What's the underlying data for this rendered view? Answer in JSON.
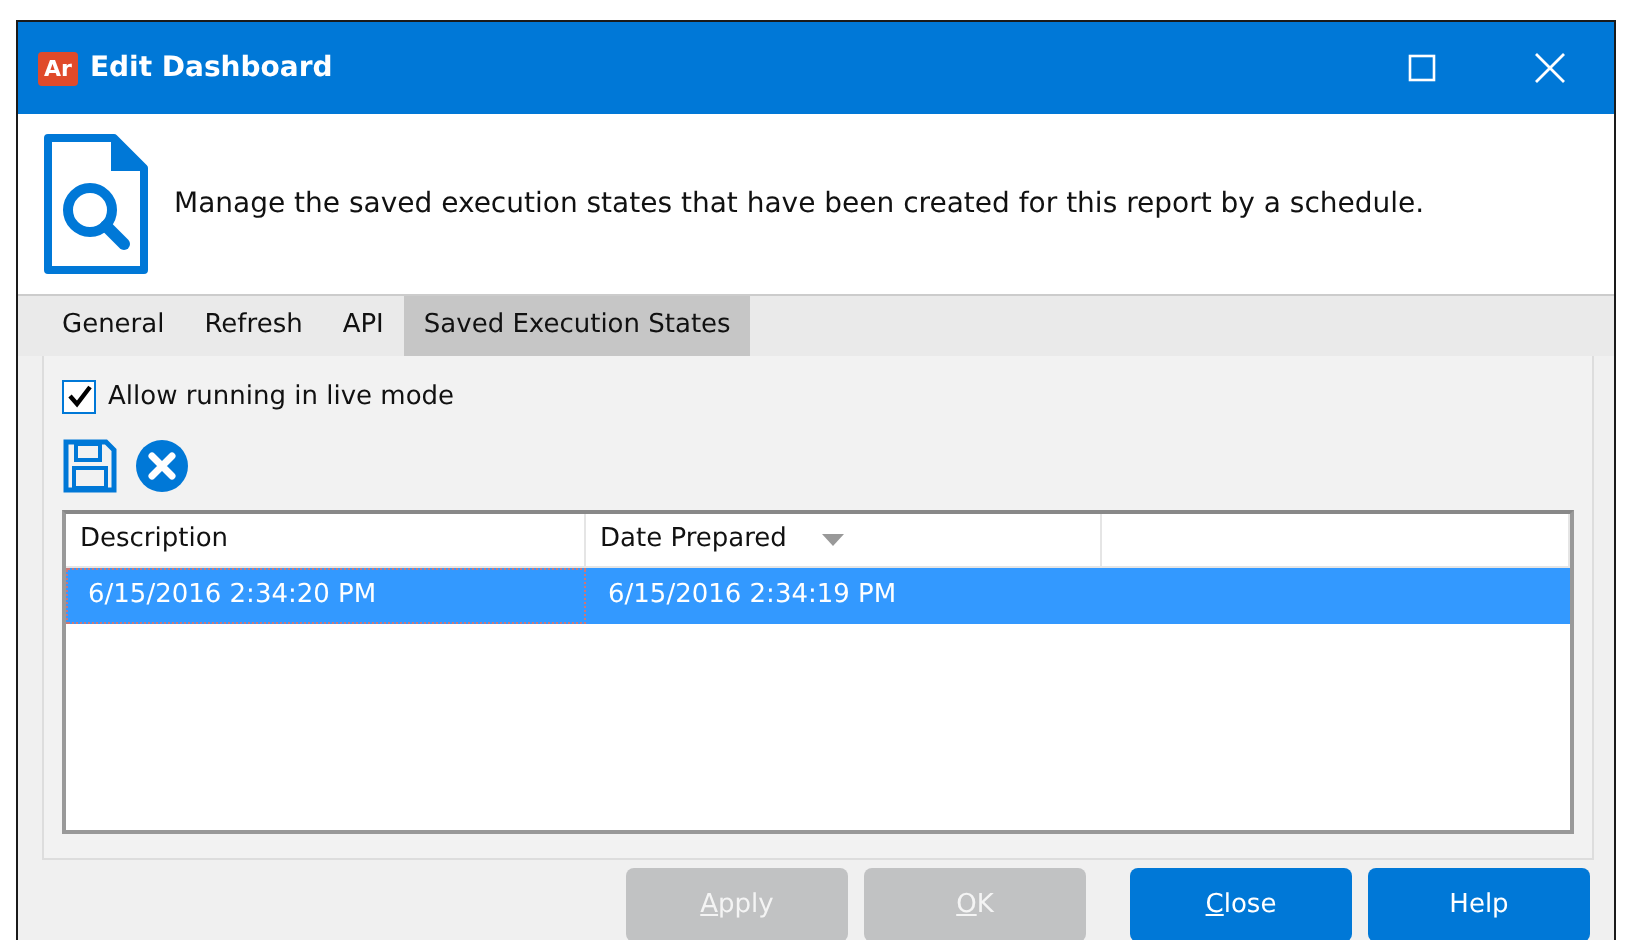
{
  "window": {
    "app_badge": "Ar",
    "title": "Edit Dashboard"
  },
  "header": {
    "message": "Manage the saved execution states that have been created for this report by a schedule."
  },
  "tabs": [
    {
      "label": "General",
      "selected": false
    },
    {
      "label": "Refresh",
      "selected": false
    },
    {
      "label": "API",
      "selected": false
    },
    {
      "label": "Saved Execution States",
      "selected": true
    }
  ],
  "live_mode": {
    "label": "Allow running in live mode",
    "checked": true
  },
  "table": {
    "columns": [
      {
        "label": "Description",
        "sorted": false
      },
      {
        "label": "Date Prepared",
        "sorted": true
      }
    ],
    "rows": [
      {
        "cells": [
          "6/15/2016 2:34:20 PM",
          "6/15/2016 2:34:19 PM"
        ],
        "selected": true
      }
    ]
  },
  "buttons": [
    {
      "label": "Apply",
      "disabled": true,
      "underline_first": true
    },
    {
      "label": "OK",
      "disabled": true,
      "underline_first": true
    },
    {
      "label": "Close",
      "disabled": false,
      "underline_first": true
    },
    {
      "label": "Help",
      "disabled": false,
      "underline_first": false
    }
  ]
}
